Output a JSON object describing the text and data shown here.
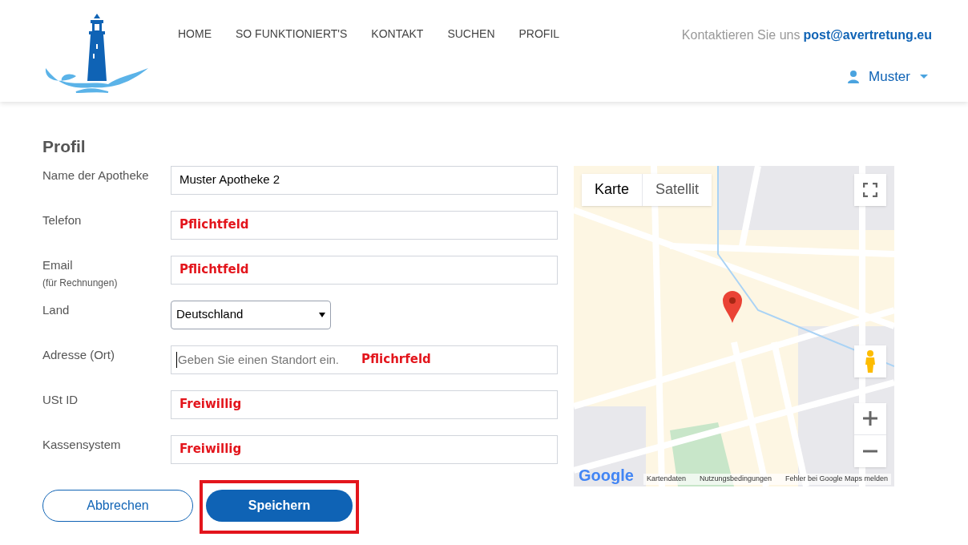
{
  "nav": [
    {
      "label": "HOME"
    },
    {
      "label": "SO FUNKTIONIERT'S"
    },
    {
      "label": "KONTAKT"
    },
    {
      "label": "SUCHEN"
    },
    {
      "label": "PROFIL"
    }
  ],
  "contact": {
    "text": "Kontaktieren Sie uns",
    "email": "post@avertretung.eu"
  },
  "user": {
    "name": "Muster"
  },
  "page_title": "Profil",
  "fields": [
    {
      "kind": "text",
      "label": "Name der Apotheke",
      "value": "Muster Apotheke 2"
    },
    {
      "kind": "text",
      "label": "Telefon",
      "note": "Pflichtfeld"
    },
    {
      "kind": "text",
      "label": "Email",
      "sublabel": "(für Rechnungen)",
      "note": "Pflichtfeld"
    },
    {
      "kind": "select",
      "label": "Land",
      "value": "Deutschland"
    },
    {
      "kind": "location",
      "label": "Adresse (Ort)",
      "placeholder": "Geben Sie einen Standort ein.",
      "note": "Pflichrfeld"
    },
    {
      "kind": "text",
      "label": "USt ID",
      "note": "Freiwillig"
    },
    {
      "kind": "text",
      "label": "Kassensystem",
      "note": "Freiwillig"
    }
  ],
  "buttons": [
    {
      "kind": "outline",
      "label": "Abbrechen",
      "highlighted": false
    },
    {
      "kind": "primary",
      "label": "Speichern",
      "highlighted": true
    }
  ],
  "map": {
    "types": [
      {
        "label": "Karte",
        "selected": true
      },
      {
        "label": "Satellit",
        "selected": false
      }
    ],
    "logo": "Google",
    "footer": [
      "Kartendaten",
      "Nutzungsbedingungen",
      "Fehler bei Google Maps melden"
    ]
  }
}
